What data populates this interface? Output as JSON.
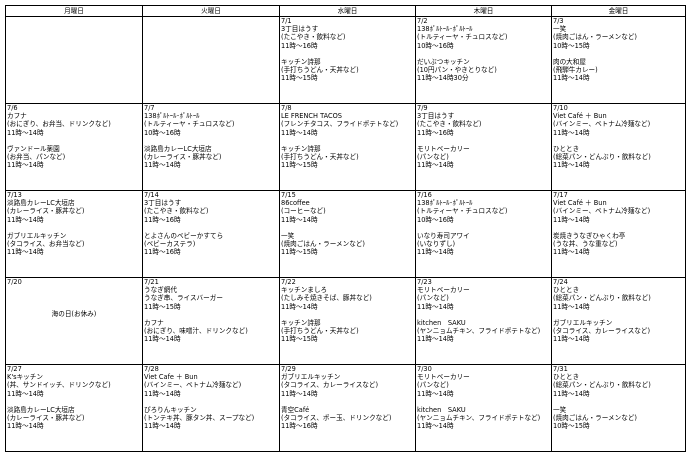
{
  "headers": [
    "月曜日",
    "火曜日",
    "水曜日",
    "木曜日",
    "金曜日"
  ],
  "weeks": [
    [
      {
        "date": "",
        "entries": []
      },
      {
        "date": "",
        "entries": []
      },
      {
        "date": "7/1",
        "entries": [
          {
            "name": "3丁目はうす",
            "desc": "(たこやき・飲料など)",
            "hours": "11時～16時"
          },
          {
            "name": "キッチン詩那",
            "desc": "(手打ちうどん・天丼など)",
            "hours": "11時～15時"
          }
        ]
      },
      {
        "date": "7/2",
        "entries": [
          {
            "name": "138ﾎﾟﾙﾄｰﾙ･ﾎﾟﾙﾄｰﾙ",
            "desc": "(トルティーヤ・チュロスなど)",
            "hours": "10時～16時"
          },
          {
            "name": "だいぶつキッチン",
            "desc": "(10円パン・やきとりなど)",
            "hours": "11時～14時30分"
          }
        ]
      },
      {
        "date": "7/3",
        "entries": [
          {
            "name": "一笑",
            "desc": "(焼肉ごはん・ラーメンなど)",
            "hours": "10時～15時"
          },
          {
            "name": "肉の大和屋",
            "desc": "(飛騨牛カレー)",
            "hours": "11時～14時"
          }
        ]
      }
    ],
    [
      {
        "date": "7/6",
        "entries": [
          {
            "name": "カフナ",
            "desc": "(おにぎり、お弁当、ドリンクなど)",
            "hours": "11時～14時"
          },
          {
            "name": "ヴァンドール薬園",
            "desc": "(お弁当、パンなど)",
            "hours": "11時～14時"
          }
        ]
      },
      {
        "date": "7/7",
        "entries": [
          {
            "name": "138ﾎﾟﾙﾄｰﾙ･ﾎﾟﾙﾄｰﾙ",
            "desc": "(トルティーヤ・チュロスなど)",
            "hours": "10時～16時"
          },
          {
            "name": "淡路島カレーLC大垣店",
            "desc": "(カレーライス・豚丼など)",
            "hours": "11時～14時"
          }
        ]
      },
      {
        "date": "7/8",
        "entries": [
          {
            "name": "LE FRENCH TACOS",
            "desc": "(フレンチタコス、フライドポテトなど)",
            "hours": "11時～14時"
          },
          {
            "name": "キッチン詩那",
            "desc": "(手打ちうどん・天丼など)",
            "hours": "11時～15時"
          }
        ]
      },
      {
        "date": "7/9",
        "entries": [
          {
            "name": "3丁目はうす",
            "desc": "(たこやき・飲料など)",
            "hours": "11時～16時"
          },
          {
            "name": "モリトベーカリー",
            "desc": "(パンなど)",
            "hours": "11時～14時"
          }
        ]
      },
      {
        "date": "7/10",
        "entries": [
          {
            "name": "Viet Café ＋ Bun",
            "desc": "(バインミー、ベトナム冷麺など)",
            "hours": "11時～14時"
          },
          {
            "name": "ひととき",
            "desc": "(総菜パン・どんぶり・飲料など)",
            "hours": "11時～14時"
          }
        ]
      }
    ],
    [
      {
        "date": "7/13",
        "entries": [
          {
            "name": "淡路島カレーLC大垣店",
            "desc": "(カレーライス・豚丼など)",
            "hours": "11時～14時"
          },
          {
            "name": "ガブリエルキッチン",
            "desc": "(タコライス、お弁当など)",
            "hours": "11時～14時"
          }
        ]
      },
      {
        "date": "7/14",
        "entries": [
          {
            "name": "3丁目はうす",
            "desc": "(たこやき・飲料など)",
            "hours": "11時～16時"
          },
          {
            "name": "とよさんのベビーかすてら",
            "desc": "(ベビーカステラ)",
            "hours": "11時～16時"
          }
        ]
      },
      {
        "date": "7/15",
        "entries": [
          {
            "name": "86coffee",
            "desc": "(コーヒーなど)",
            "hours": "11時～14時"
          },
          {
            "name": "一笑",
            "desc": "(焼肉ごはん・ラーメンなど)",
            "hours": "11時～15時"
          }
        ]
      },
      {
        "date": "7/16",
        "entries": [
          {
            "name": "138ﾎﾟﾙﾄｰﾙ･ﾎﾟﾙﾄｰﾙ",
            "desc": "(トルティーヤ・チュロスなど)",
            "hours": "10時～16時"
          },
          {
            "name": "いなり寿司アワイ",
            "desc": "(いなりずし)",
            "hours": "11時～14時"
          }
        ]
      },
      {
        "date": "7/17",
        "entries": [
          {
            "name": "Viet Café ＋ Bun",
            "desc": "(バインミー、ベトナム冷麺など)",
            "hours": "11時～14時"
          },
          {
            "name": "炭焼きうなぎひゃくわ亭",
            "desc": "(うな丼、うな重など)",
            "hours": "11時～14時"
          }
        ]
      }
    ],
    [
      {
        "date": "7/20",
        "holiday": "海の日(お休み)",
        "entries": []
      },
      {
        "date": "7/21",
        "entries": [
          {
            "name": "うなぎ網代",
            "desc": "うなぎ串、ライスバーガー",
            "hours": "11時～15時"
          },
          {
            "name": "カフナ",
            "desc": "(おにぎり、味噌汁、ドリンクなど)",
            "hours": "11時～14時"
          }
        ]
      },
      {
        "date": "7/22",
        "entries": [
          {
            "name": "キッチンましろ",
            "desc": "(たしみそ焼きそば、豚丼など)",
            "hours": "11時～14時"
          },
          {
            "name": "キッチン詩那",
            "desc": "(手打ちうどん・天丼など)",
            "hours": "11時～15時"
          }
        ]
      },
      {
        "date": "7/23",
        "entries": [
          {
            "name": "モリトベーカリー",
            "desc": "(パンなど)",
            "hours": "11時～14時"
          },
          {
            "name": "kitchen　SAKU",
            "desc": "(ヤンニョムチキン、フライドポテトなど)",
            "hours": "11時～14時"
          }
        ]
      },
      {
        "date": "7/24",
        "entries": [
          {
            "name": "ひととき",
            "desc": "(総菜パン・どんぶり・飲料など)",
            "hours": "11時～14時"
          },
          {
            "name": "ガブリエルキッチン",
            "desc": "(タコライス、カレーライスなど)",
            "hours": "11時～14時"
          }
        ]
      }
    ],
    [
      {
        "date": "7/27",
        "entries": [
          {
            "name": "K'sキッチン",
            "desc": "(丼、サンドイッチ、ドリンクなど)",
            "hours": "11時～14時"
          },
          {
            "name": "淡路島カレーLC大垣店",
            "desc": "(カレーライス・豚丼など)",
            "hours": "11時～14時"
          }
        ]
      },
      {
        "date": "7/28",
        "entries": [
          {
            "name": "Viet Cafe ＋ Bun",
            "desc": "(バインミー、ベトナム冷麺など)",
            "hours": "11時～14時"
          },
          {
            "name": "ぴろりんキッチン",
            "desc": "(トンテキ丼、豚タン丼、スープなど)",
            "hours": "11時～14時"
          }
        ]
      },
      {
        "date": "7/29",
        "entries": [
          {
            "name": "ガブリエルキッチン",
            "desc": "(タコライス、カレーライスなど)",
            "hours": "11時～14時"
          },
          {
            "name": "青空Café",
            "desc": "(タコライス、ポー玉、ドリンクなど)",
            "hours": "11時～16時"
          }
        ]
      },
      {
        "date": "7/30",
        "entries": [
          {
            "name": "モリトベーカリー",
            "desc": "(パンなど)",
            "hours": "11時～14時"
          },
          {
            "name": "kitchen　SAKU",
            "desc": "(ヤンニョムチキン、フライドポテトなど)",
            "hours": "11時～14時"
          }
        ]
      },
      {
        "date": "7/31",
        "entries": [
          {
            "name": "ひととき",
            "desc": "(総菜パン・どんぶり・飲料など)",
            "hours": "11時～14時"
          },
          {
            "name": "一笑",
            "desc": "(焼肉ごはん・ラーメンなど)",
            "hours": "10時～15時"
          }
        ]
      }
    ]
  ]
}
